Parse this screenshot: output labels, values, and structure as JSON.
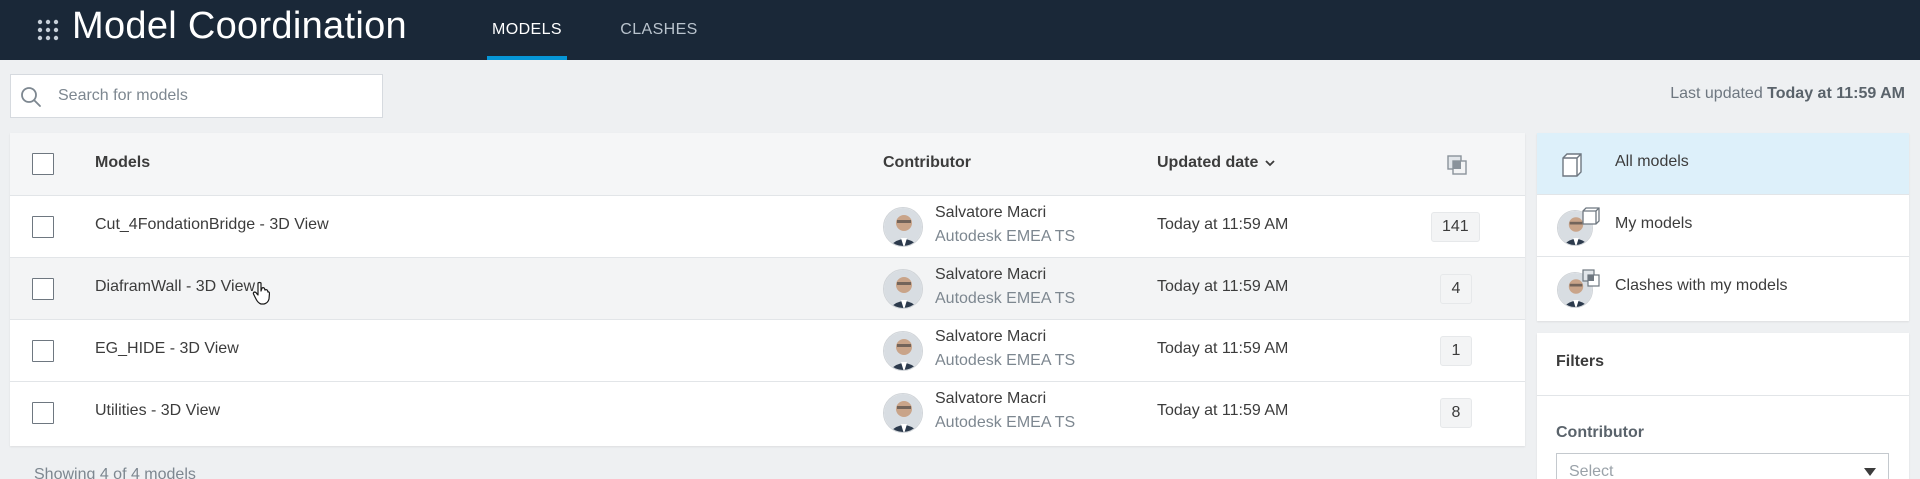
{
  "app": {
    "title": "Model Coordination"
  },
  "tabs": [
    {
      "label": "MODELS",
      "active": true
    },
    {
      "label": "CLASHES",
      "active": false
    }
  ],
  "search": {
    "placeholder": "Search for models",
    "value": ""
  },
  "last_updated": {
    "prefix": "Last updated ",
    "value": "Today at 11:59 AM"
  },
  "table": {
    "columns": {
      "models": "Models",
      "contributor": "Contributor",
      "updated": "Updated date"
    },
    "rows": [
      {
        "name": "Cut_4FondationBridge - 3D View",
        "contributor": "Salvatore Macri",
        "org": "Autodesk EMEA TS",
        "date": "Today at 11:59 AM",
        "count": "141"
      },
      {
        "name": "DiaframWall - 3D View",
        "contributor": "Salvatore Macri",
        "org": "Autodesk EMEA TS",
        "date": "Today at 11:59 AM",
        "count": "4"
      },
      {
        "name": "EG_HIDE - 3D View",
        "contributor": "Salvatore Macri",
        "org": "Autodesk EMEA TS",
        "date": "Today at 11:59 AM",
        "count": "1"
      },
      {
        "name": "Utilities - 3D View",
        "contributor": "Salvatore Macri",
        "org": "Autodesk EMEA TS",
        "date": "Today at 11:59 AM",
        "count": "8"
      }
    ],
    "footer": "Showing 4 of 4 models"
  },
  "views": [
    {
      "label": "All models",
      "selected": true
    },
    {
      "label": "My models",
      "selected": false
    },
    {
      "label": "Clashes with my models",
      "selected": false
    }
  ],
  "filters": {
    "title": "Filters",
    "contributor_label": "Contributor",
    "contributor_placeholder": "Select"
  },
  "colors": {
    "topbar": "#1a2838",
    "accent": "#0696d7",
    "selected_bg": "#ddf0fa"
  },
  "icons": [
    "grid-icon",
    "search-icon",
    "sort-chevron-icon",
    "clash-count-icon",
    "cube-icon",
    "avatar",
    "caret-down-icon",
    "mouse-cursor"
  ]
}
